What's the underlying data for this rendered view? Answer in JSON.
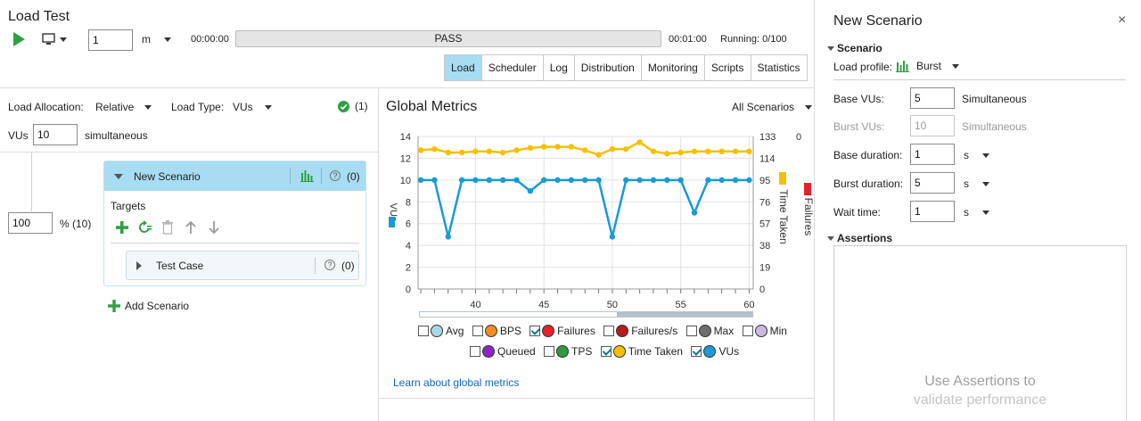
{
  "header": {
    "title": "Load Test",
    "duration_value": "1",
    "duration_unit": "m",
    "elapsed": "00:00:00",
    "status": "PASS",
    "remaining": "00:01:00",
    "running": "Running: 0/100",
    "tabs": [
      "Load",
      "Scheduler",
      "Log",
      "Distribution",
      "Monitoring",
      "Scripts",
      "Statistics"
    ],
    "active_tab": "Load"
  },
  "allocation": {
    "label": "Load Allocation:",
    "value": "Relative",
    "type_label": "Load Type:",
    "type_value": "VUs",
    "check_count": "(1)",
    "vus_label": "VUs",
    "vus_value": "10",
    "vus_suffix": "simultaneous",
    "percent_value": "100",
    "percent_suffix": "% (10)"
  },
  "scenario": {
    "name": "New Scenario",
    "count": "(0)",
    "targets_label": "Targets",
    "test_case": "Test Case",
    "test_case_count": "(0)",
    "add_label": "Add Scenario"
  },
  "metrics": {
    "title": "Global Metrics",
    "filter": "All Scenarios",
    "learn_link": "Learn about global metrics",
    "legend": [
      {
        "label": "Avg",
        "color": "#a8d8e8",
        "checked": false
      },
      {
        "label": "BPS",
        "color": "#f58a1f",
        "checked": false
      },
      {
        "label": "Failures",
        "color": "#e8222d",
        "checked": true
      },
      {
        "label": "Failures/s",
        "color": "#b71c1c",
        "checked": false
      },
      {
        "label": "Max",
        "color": "#6d6d6d",
        "checked": false
      },
      {
        "label": "Min",
        "color": "#cdb8e0",
        "checked": false
      },
      {
        "label": "Queued",
        "color": "#8e24c8",
        "checked": false
      },
      {
        "label": "TPS",
        "color": "#2e9b40",
        "checked": false
      },
      {
        "label": "Time Taken",
        "color": "#f5c000",
        "checked": true
      },
      {
        "label": "VUs",
        "color": "#1a9ad6",
        "checked": true
      }
    ]
  },
  "chart_data": {
    "type": "line",
    "x": [
      36,
      37,
      38,
      39,
      40,
      41,
      42,
      43,
      44,
      45,
      46,
      47,
      48,
      49,
      50,
      51,
      52,
      53,
      54,
      55,
      56,
      57,
      58,
      59,
      60
    ],
    "x_ticks": [
      "40",
      "45",
      "50",
      "55",
      "60"
    ],
    "xlim": [
      35.8,
      60.3
    ],
    "left_axis": {
      "label": "VUs",
      "ticks": [
        "0",
        "2",
        "4",
        "6",
        "8",
        "10",
        "12",
        "14"
      ],
      "ylim": [
        0,
        14
      ]
    },
    "right_axis": {
      "label": "Time Taken",
      "ticks": [
        "0",
        "19",
        "38",
        "57",
        "76",
        "95",
        "114",
        "133"
      ],
      "ylim": [
        0,
        133
      ]
    },
    "failures_axis": {
      "label": "Failures",
      "tick": "0"
    },
    "series": [
      {
        "name": "VUs",
        "axis": "left",
        "color": "#1a9ad6",
        "values": [
          10,
          10,
          4.8,
          10,
          10,
          10,
          10,
          10,
          9,
          10,
          10,
          10,
          10,
          10,
          4.8,
          10,
          10,
          10,
          10,
          10,
          7,
          10,
          10,
          10,
          10
        ]
      },
      {
        "name": "Time Taken",
        "axis": "right",
        "color": "#f5c000",
        "values": [
          121,
          122,
          119,
          119,
          120,
          120,
          119,
          121,
          123,
          124,
          124,
          124,
          121,
          117,
          122,
          122,
          128,
          120,
          118,
          119,
          120,
          120,
          120,
          120,
          120
        ]
      }
    ]
  },
  "panel": {
    "title": "New Scenario",
    "scenario_header": "Scenario",
    "load_profile_label": "Load profile:",
    "load_profile_value": "Burst",
    "base_vus_label": "Base VUs:",
    "base_vus_value": "5",
    "base_vus_suffix": "Simultaneous",
    "burst_vus_label": "Burst VUs:",
    "burst_vus_value": "10",
    "burst_vus_suffix": "Simultaneous",
    "base_duration_label": "Base duration:",
    "base_duration_value": "1",
    "base_duration_unit": "s",
    "burst_duration_label": "Burst duration:",
    "burst_duration_value": "5",
    "burst_duration_unit": "s",
    "wait_time_label": "Wait time:",
    "wait_time_value": "1",
    "wait_time_unit": "s",
    "assertions_header": "Assertions",
    "assertions_hint_1": "Use Assertions to",
    "assertions_hint_2": "validate performance"
  }
}
